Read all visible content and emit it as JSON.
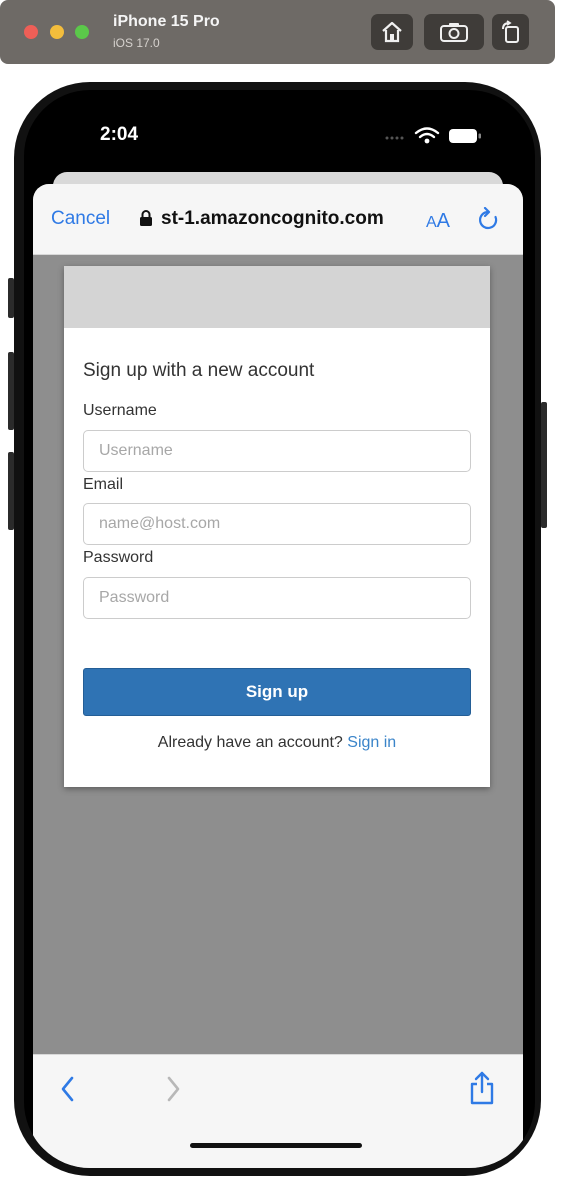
{
  "simulator": {
    "device_name": "iPhone 15 Pro",
    "os_version": "iOS 17.0",
    "buttons": [
      "home-icon",
      "screenshot-icon",
      "rotate-icon"
    ]
  },
  "status_bar": {
    "time": "2:04",
    "icons": [
      "wifi-icon",
      "battery-icon"
    ]
  },
  "browser": {
    "cancel_label": "Cancel",
    "url": "st-1.amazoncognito.com",
    "text_size_small": "A",
    "text_size_big": "A",
    "icons": [
      "lock-icon",
      "reload-icon",
      "back-icon",
      "forward-icon",
      "share-icon"
    ],
    "accent_color": "#2f7ae5"
  },
  "signup_form": {
    "title": "Sign up with a new account",
    "username": {
      "label": "Username",
      "placeholder": "Username",
      "value": ""
    },
    "email": {
      "label": "Email",
      "placeholder": "name@host.com",
      "value": ""
    },
    "password": {
      "label": "Password",
      "placeholder": "Password",
      "value": ""
    },
    "submit_label": "Sign up",
    "submit_color": "#2f73b4",
    "signin_prompt": "Already have an account?",
    "signin_link": "Sign in"
  }
}
